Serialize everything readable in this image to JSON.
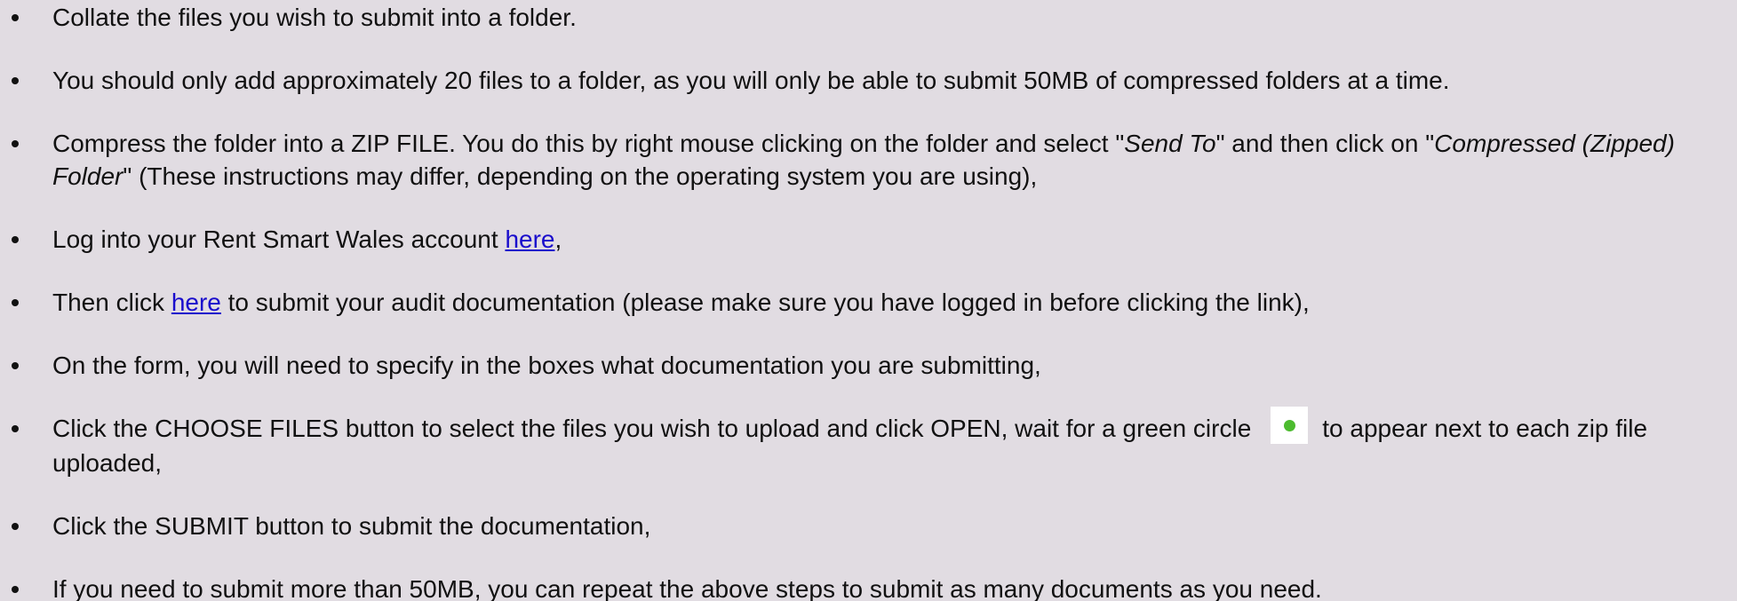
{
  "colors": {
    "background": "#e1dce2",
    "text": "#111111",
    "link": "#1a0dcc",
    "status_dot": "#4cbb2f"
  },
  "steps": [
    {
      "text": "Collate the files you wish to submit into a folder."
    },
    {
      "text": "You should only add approximately 20 files to a folder, as you will only be able to submit 50MB of compressed folders at a time."
    },
    {
      "a": "Compress the folder into a ZIP FILE. You do this by right mouse clicking on the folder and select \"",
      "em1": "Send To",
      "b": "\" and then click on \"",
      "em2": "Compressed (Zipped) Folder",
      "c": "\" (These instructions may differ, depending on the operating system you are using),"
    },
    {
      "a": "Log into your Rent Smart Wales account ",
      "link": "here",
      "b": ","
    },
    {
      "a": "Then click ",
      "link": "here",
      "b": " to submit your audit documentation (please make sure you have logged in before clicking the link),"
    },
    {
      "text": "On the form, you will need to specify in the boxes what documentation you are submitting,"
    },
    {
      "a": "Click the CHOOSE FILES button to select the files you wish to upload and click OPEN, wait for a green circle",
      "icon": "green-circle-icon",
      "b": "to appear next to each zip file uploaded,"
    },
    {
      "text": "Click the SUBMIT button to submit the documentation,"
    },
    {
      "text": "If you need to submit more than 50MB, you can repeat the above steps to submit as many documents as you need."
    }
  ]
}
